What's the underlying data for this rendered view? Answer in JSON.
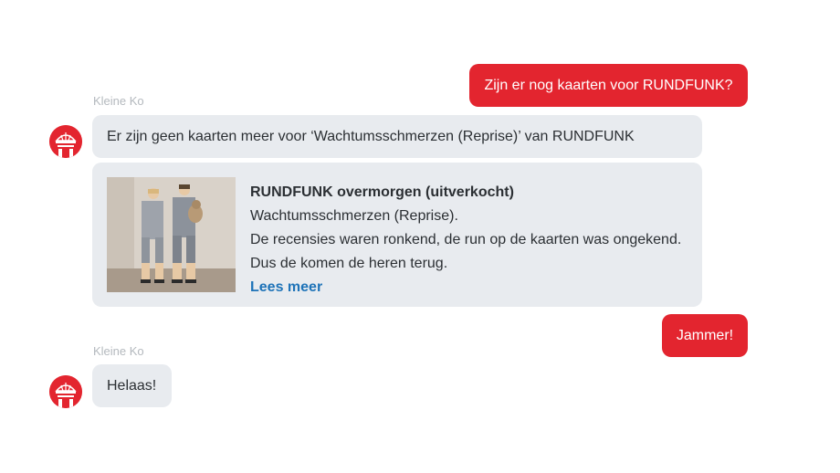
{
  "messages": {
    "user_1": "Zijn er nog kaarten voor RUNDFUNK?",
    "bot_1_sender": "Kleine Ko",
    "bot_1_text": "Er zijn geen kaarten meer voor ‘Wachtumsschmerzen (Reprise)’ van RUNDFUNK",
    "card": {
      "title": "RUNDFUNK overmorgen (uitverkocht)",
      "line_1": "Wachtumsschmerzen (Reprise).",
      "line_2": "De recensies waren ronkend, de run op de kaarten was ongekend.",
      "line_3": "Dus de komen de heren terug.",
      "link": "Lees meer"
    },
    "user_2": "Jammer!",
    "bot_2_sender": "Kleine Ko",
    "bot_2_text": "Helaas!"
  },
  "icons": {
    "avatar": "kleine-ko-logo-icon"
  },
  "colors": {
    "user_bubble": "#e3252f",
    "bot_bubble": "#e8ebef",
    "link": "#1e73b8"
  }
}
